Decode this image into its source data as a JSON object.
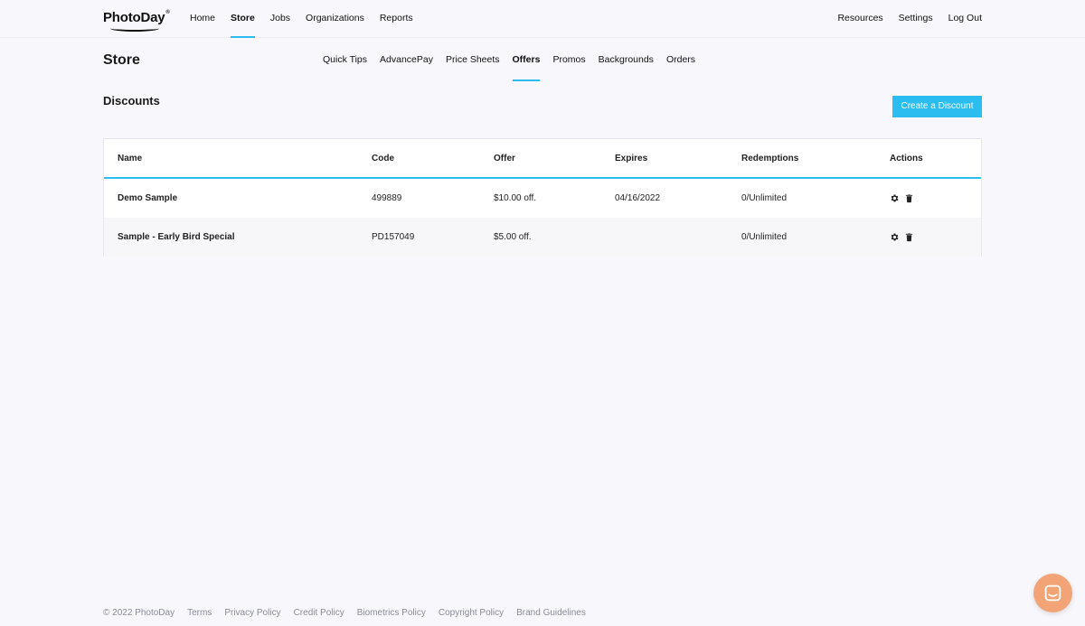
{
  "brand": {
    "logo_text": "PhotoDay",
    "accent": "#2bbcf0",
    "chat_color": "#f2a477"
  },
  "topnav": {
    "left": [
      "Home",
      "Store",
      "Jobs",
      "Organizations",
      "Reports"
    ],
    "active": "Store",
    "right": [
      "Resources",
      "Settings",
      "Log Out"
    ]
  },
  "page": {
    "title": "Store",
    "subnav": [
      "Quick Tips",
      "AdvancePay",
      "Price Sheets",
      "Offers",
      "Promos",
      "Backgrounds",
      "Orders"
    ],
    "active_sub": "Offers"
  },
  "discounts": {
    "title": "Discounts",
    "create_label": "Create a Discount",
    "columns": [
      "Name",
      "Code",
      "Offer",
      "Expires",
      "Redemptions",
      "Actions"
    ],
    "rows": [
      {
        "name": "Demo Sample",
        "code": "499889",
        "offer": "$10.00 off.",
        "expires": "04/16/2022",
        "redemptions": "0/Unlimited"
      },
      {
        "name": "Sample - Early Bird Special",
        "code": "PD157049",
        "offer": "$5.00 off.",
        "expires": "",
        "redemptions": "0/Unlimited"
      }
    ],
    "action_icons": [
      "gear-icon",
      "trash-icon"
    ]
  },
  "footer": {
    "copyright": "© 2022 PhotoDay",
    "links": [
      "Terms",
      "Privacy Policy",
      "Credit Policy",
      "Biometrics Policy",
      "Copyright Policy",
      "Brand Guidelines"
    ]
  },
  "chat": {
    "icon": "chat-icon"
  }
}
